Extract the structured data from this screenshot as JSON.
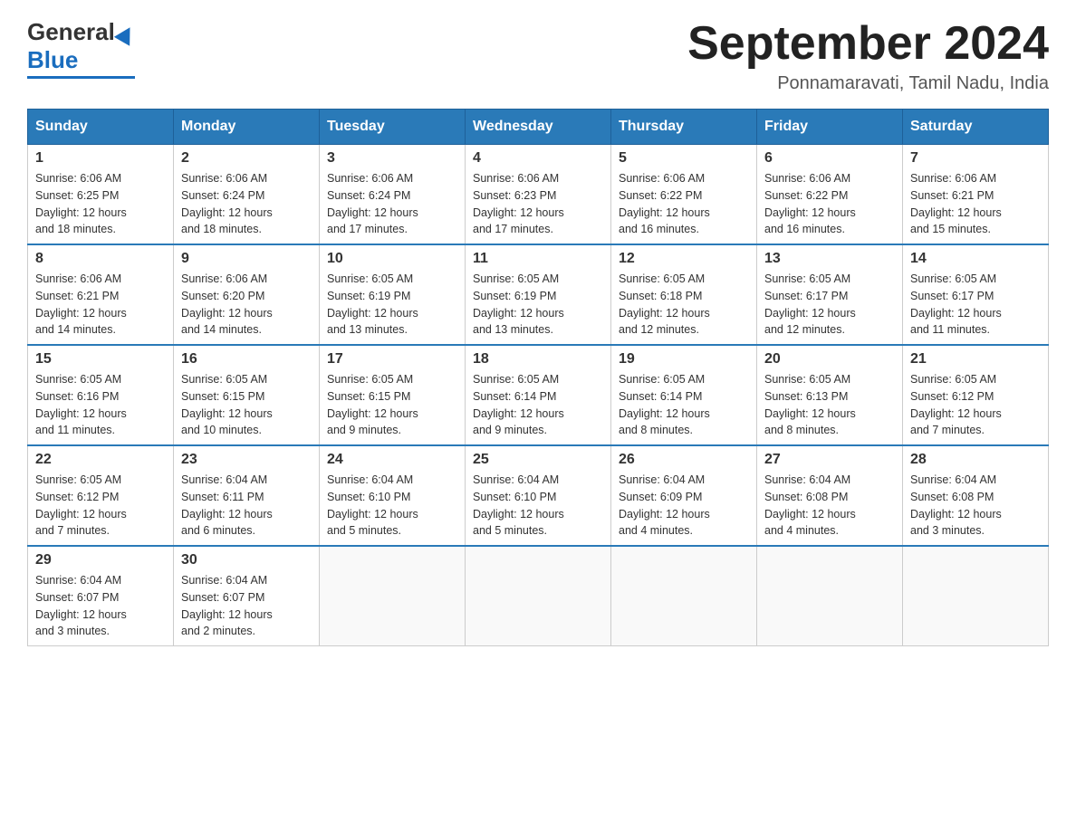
{
  "logo": {
    "general": "General",
    "blue": "Blue"
  },
  "title": "September 2024",
  "subtitle": "Ponnamaravati, Tamil Nadu, India",
  "days_of_week": [
    "Sunday",
    "Monday",
    "Tuesday",
    "Wednesday",
    "Thursday",
    "Friday",
    "Saturday"
  ],
  "weeks": [
    [
      {
        "day": "1",
        "sunrise": "6:06 AM",
        "sunset": "6:25 PM",
        "daylight": "12 hours and 18 minutes."
      },
      {
        "day": "2",
        "sunrise": "6:06 AM",
        "sunset": "6:24 PM",
        "daylight": "12 hours and 18 minutes."
      },
      {
        "day": "3",
        "sunrise": "6:06 AM",
        "sunset": "6:24 PM",
        "daylight": "12 hours and 17 minutes."
      },
      {
        "day": "4",
        "sunrise": "6:06 AM",
        "sunset": "6:23 PM",
        "daylight": "12 hours and 17 minutes."
      },
      {
        "day": "5",
        "sunrise": "6:06 AM",
        "sunset": "6:22 PM",
        "daylight": "12 hours and 16 minutes."
      },
      {
        "day": "6",
        "sunrise": "6:06 AM",
        "sunset": "6:22 PM",
        "daylight": "12 hours and 16 minutes."
      },
      {
        "day": "7",
        "sunrise": "6:06 AM",
        "sunset": "6:21 PM",
        "daylight": "12 hours and 15 minutes."
      }
    ],
    [
      {
        "day": "8",
        "sunrise": "6:06 AM",
        "sunset": "6:21 PM",
        "daylight": "12 hours and 14 minutes."
      },
      {
        "day": "9",
        "sunrise": "6:06 AM",
        "sunset": "6:20 PM",
        "daylight": "12 hours and 14 minutes."
      },
      {
        "day": "10",
        "sunrise": "6:05 AM",
        "sunset": "6:19 PM",
        "daylight": "12 hours and 13 minutes."
      },
      {
        "day": "11",
        "sunrise": "6:05 AM",
        "sunset": "6:19 PM",
        "daylight": "12 hours and 13 minutes."
      },
      {
        "day": "12",
        "sunrise": "6:05 AM",
        "sunset": "6:18 PM",
        "daylight": "12 hours and 12 minutes."
      },
      {
        "day": "13",
        "sunrise": "6:05 AM",
        "sunset": "6:17 PM",
        "daylight": "12 hours and 12 minutes."
      },
      {
        "day": "14",
        "sunrise": "6:05 AM",
        "sunset": "6:17 PM",
        "daylight": "12 hours and 11 minutes."
      }
    ],
    [
      {
        "day": "15",
        "sunrise": "6:05 AM",
        "sunset": "6:16 PM",
        "daylight": "12 hours and 11 minutes."
      },
      {
        "day": "16",
        "sunrise": "6:05 AM",
        "sunset": "6:15 PM",
        "daylight": "12 hours and 10 minutes."
      },
      {
        "day": "17",
        "sunrise": "6:05 AM",
        "sunset": "6:15 PM",
        "daylight": "12 hours and 9 minutes."
      },
      {
        "day": "18",
        "sunrise": "6:05 AM",
        "sunset": "6:14 PM",
        "daylight": "12 hours and 9 minutes."
      },
      {
        "day": "19",
        "sunrise": "6:05 AM",
        "sunset": "6:14 PM",
        "daylight": "12 hours and 8 minutes."
      },
      {
        "day": "20",
        "sunrise": "6:05 AM",
        "sunset": "6:13 PM",
        "daylight": "12 hours and 8 minutes."
      },
      {
        "day": "21",
        "sunrise": "6:05 AM",
        "sunset": "6:12 PM",
        "daylight": "12 hours and 7 minutes."
      }
    ],
    [
      {
        "day": "22",
        "sunrise": "6:05 AM",
        "sunset": "6:12 PM",
        "daylight": "12 hours and 7 minutes."
      },
      {
        "day": "23",
        "sunrise": "6:04 AM",
        "sunset": "6:11 PM",
        "daylight": "12 hours and 6 minutes."
      },
      {
        "day": "24",
        "sunrise": "6:04 AM",
        "sunset": "6:10 PM",
        "daylight": "12 hours and 5 minutes."
      },
      {
        "day": "25",
        "sunrise": "6:04 AM",
        "sunset": "6:10 PM",
        "daylight": "12 hours and 5 minutes."
      },
      {
        "day": "26",
        "sunrise": "6:04 AM",
        "sunset": "6:09 PM",
        "daylight": "12 hours and 4 minutes."
      },
      {
        "day": "27",
        "sunrise": "6:04 AM",
        "sunset": "6:08 PM",
        "daylight": "12 hours and 4 minutes."
      },
      {
        "day": "28",
        "sunrise": "6:04 AM",
        "sunset": "6:08 PM",
        "daylight": "12 hours and 3 minutes."
      }
    ],
    [
      {
        "day": "29",
        "sunrise": "6:04 AM",
        "sunset": "6:07 PM",
        "daylight": "12 hours and 3 minutes."
      },
      {
        "day": "30",
        "sunrise": "6:04 AM",
        "sunset": "6:07 PM",
        "daylight": "12 hours and 2 minutes."
      },
      null,
      null,
      null,
      null,
      null
    ]
  ],
  "labels": {
    "sunrise": "Sunrise:",
    "sunset": "Sunset:",
    "daylight": "Daylight:"
  }
}
